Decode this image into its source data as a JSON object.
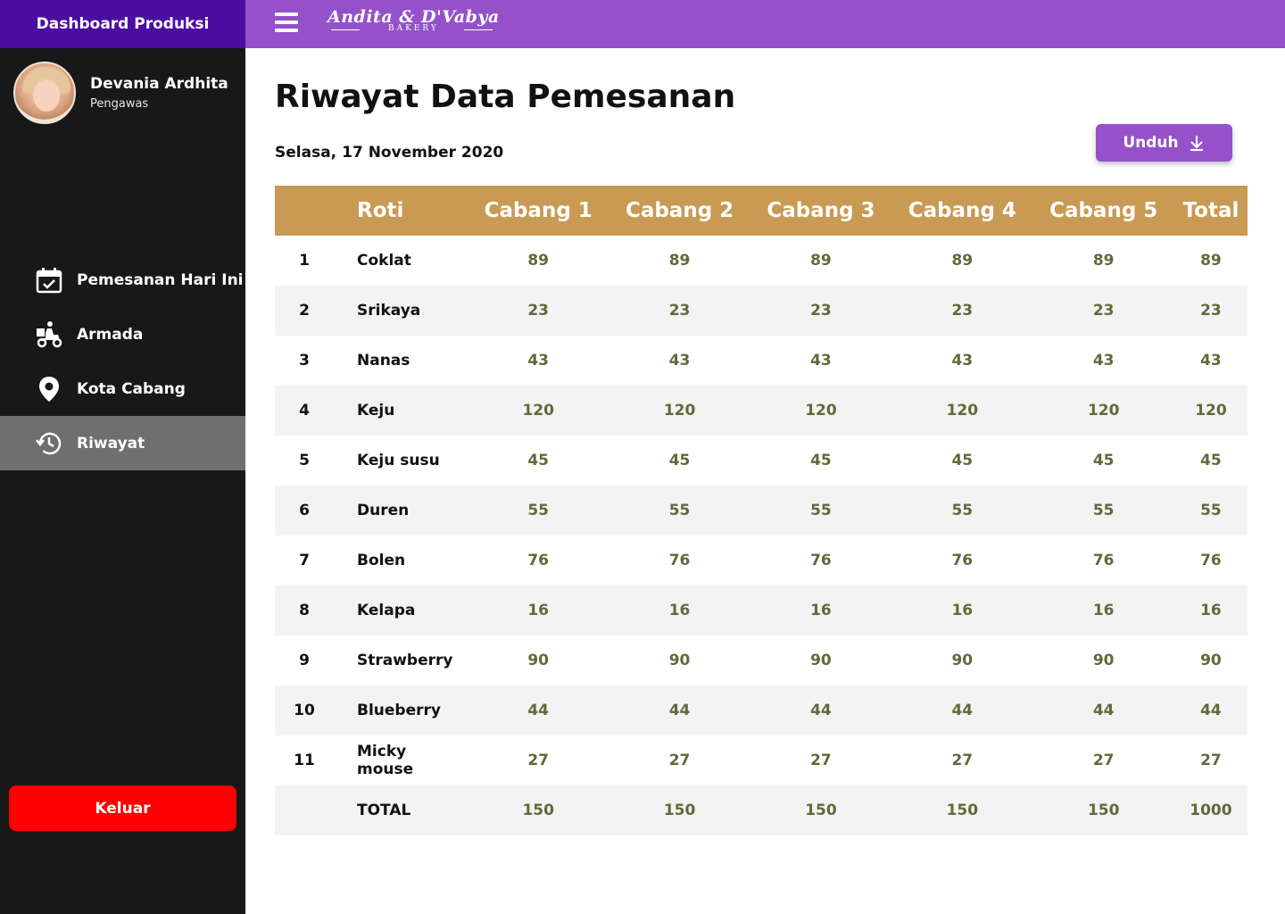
{
  "sidebar": {
    "title": "Dashboard Produksi",
    "profile": {
      "name": "Devania Ardhita",
      "role": "Pengawas"
    },
    "items": [
      {
        "label": "Pemesanan Hari Ini",
        "icon": "calendar-check-icon"
      },
      {
        "label": "Armada",
        "icon": "delivery-scooter-icon"
      },
      {
        "label": "Kota Cabang",
        "icon": "location-pin-icon"
      },
      {
        "label": "Riwayat",
        "icon": "history-icon",
        "active": true
      }
    ],
    "logout_label": "Keluar"
  },
  "topbar": {
    "brand_name": "Andita & D'Vabya",
    "brand_sub": "BAKERY"
  },
  "main": {
    "title": "Riwayat Data Pemesanan",
    "date_day": "Selasa,",
    "date_value": "17 November 2020",
    "download_label": "Unduh"
  },
  "table": {
    "headers": [
      "",
      "Roti",
      "Cabang 1",
      "Cabang 2",
      "Cabang 3",
      "Cabang 4",
      "Cabang 5",
      "Total"
    ],
    "rows": [
      {
        "no": "1",
        "name": "Coklat",
        "values": [
          "89",
          "89",
          "89",
          "89",
          "89",
          "89"
        ]
      },
      {
        "no": "2",
        "name": "Srikaya",
        "values": [
          "23",
          "23",
          "23",
          "23",
          "23",
          "23"
        ]
      },
      {
        "no": "3",
        "name": "Nanas",
        "values": [
          "43",
          "43",
          "43",
          "43",
          "43",
          "43"
        ]
      },
      {
        "no": "4",
        "name": "Keju",
        "values": [
          "120",
          "120",
          "120",
          "120",
          "120",
          "120"
        ]
      },
      {
        "no": "5",
        "name": "Keju susu",
        "values": [
          "45",
          "45",
          "45",
          "45",
          "45",
          "45"
        ]
      },
      {
        "no": "6",
        "name": "Duren",
        "values": [
          "55",
          "55",
          "55",
          "55",
          "55",
          "55"
        ]
      },
      {
        "no": "7",
        "name": "Bolen",
        "values": [
          "76",
          "76",
          "76",
          "76",
          "76",
          "76"
        ]
      },
      {
        "no": "8",
        "name": "Kelapa",
        "values": [
          "16",
          "16",
          "16",
          "16",
          "16",
          "16"
        ]
      },
      {
        "no": "9",
        "name": "Strawberry",
        "values": [
          "90",
          "90",
          "90",
          "90",
          "90",
          "90"
        ]
      },
      {
        "no": "10",
        "name": "Blueberry",
        "values": [
          "44",
          "44",
          "44",
          "44",
          "44",
          "44"
        ]
      },
      {
        "no": "11",
        "name": "Micky mouse",
        "values": [
          "27",
          "27",
          "27",
          "27",
          "27",
          "27"
        ]
      }
    ],
    "total_row": {
      "no": "",
      "name": "TOTAL",
      "values": [
        "150",
        "150",
        "150",
        "150",
        "150",
        "1000"
      ]
    }
  },
  "colors": {
    "sidebar_bg": "#181818",
    "sidebar_header": "#4c0ea0",
    "topbar": "#9451c9",
    "table_header": "#c89a53",
    "value_text": "#5f6a3a",
    "logout": "#ff0000",
    "active_nav": "#6f6f6f"
  }
}
